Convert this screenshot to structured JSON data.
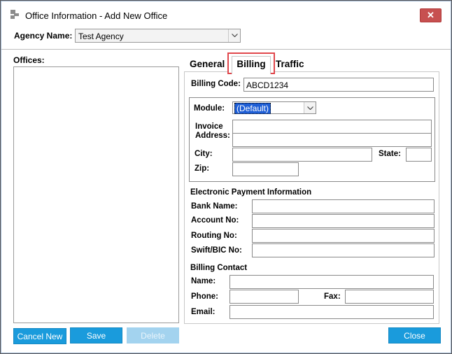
{
  "window": {
    "title": "Office Information - Add New Office",
    "close_glyph": "✕"
  },
  "agency": {
    "label": "Agency Name:",
    "value": "Test Agency"
  },
  "offices": {
    "label": "Offices:"
  },
  "tabs": [
    {
      "label": "General"
    },
    {
      "label": "Billing",
      "active": true
    },
    {
      "label": "Traffic"
    }
  ],
  "billing": {
    "billing_code_label": "Billing Code:",
    "billing_code_value": "ABCD1234",
    "module_label": "Module:",
    "module_value": "(Default)",
    "invoice_address_label_1": "Invoice",
    "invoice_address_label_2": "Address:",
    "city_label": "City:",
    "state_label": "State:",
    "zip_label": "Zip:",
    "epi_title": "Electronic Payment Information",
    "bank_name_label": "Bank Name:",
    "account_no_label": "Account No:",
    "routing_no_label": "Routing No:",
    "swift_label": "Swift/BIC No:",
    "contact_title": "Billing Contact",
    "name_label": "Name:",
    "phone_label": "Phone:",
    "fax_label": "Fax:",
    "email_label": "Email:"
  },
  "buttons": {
    "cancel_new": "Cancel New",
    "save": "Save",
    "delete": "Delete",
    "close": "Close"
  },
  "colors": {
    "accent": "#1a9bdc",
    "highlight": "#e0474c",
    "close_red": "#c75050"
  }
}
